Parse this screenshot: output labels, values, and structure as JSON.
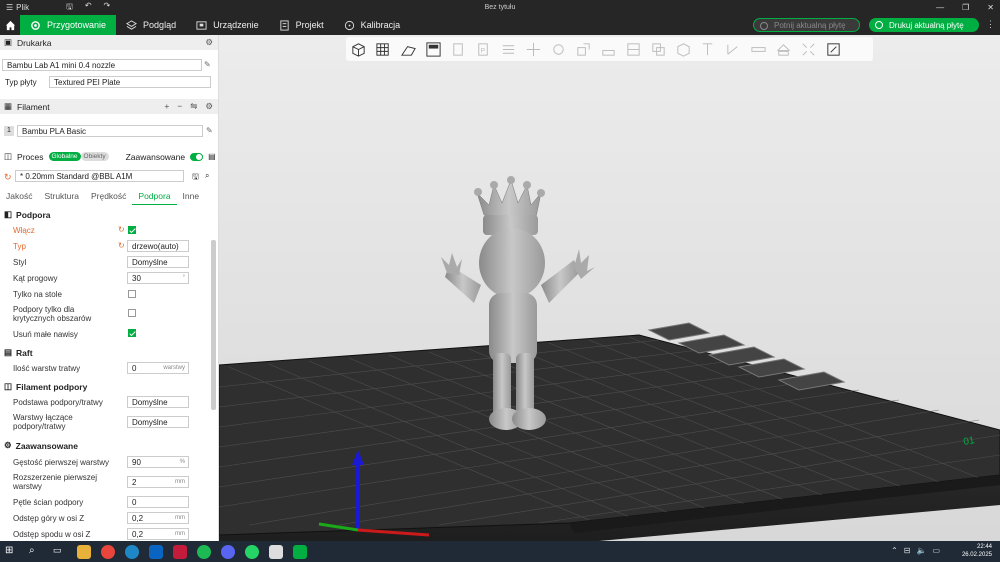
{
  "titlebar": {
    "menu_label": "Plik",
    "title": "Bez tytułu"
  },
  "tabs": [
    {
      "label": "Przygotowanie"
    },
    {
      "label": "Podgląd"
    },
    {
      "label": "Urządzenie"
    },
    {
      "label": "Projekt"
    },
    {
      "label": "Kalibracja"
    }
  ],
  "actions": {
    "slice": "Potnij aktualną płytę",
    "print": "Drukuj aktualną płytę"
  },
  "printer": {
    "section": "Drukarka",
    "name": "Bambu Lab A1 mini 0.4 nozzle",
    "plate_label": "Typ płyty",
    "plate_value": "Textured PEI Plate"
  },
  "filament": {
    "section": "Filament",
    "slot": "1",
    "value": "Bambu PLA Basic"
  },
  "process": {
    "section": "Proces",
    "global": "Globalne",
    "objects": "Obiekty",
    "advanced_label": "Zaawansowane",
    "preset": "* 0.20mm Standard @BBL A1M"
  },
  "subtabs": [
    "Jakość",
    "Struktura",
    "Prędkość",
    "Podpora",
    "Inne"
  ],
  "support": {
    "section": "Podpora",
    "enable_label": "Włącz",
    "type_label": "Typ",
    "type_value": "drzewo(auto)",
    "style_label": "Styl",
    "style_value": "Domyślne",
    "angle_label": "Kąt progowy",
    "angle_value": "30",
    "angle_unit": "°",
    "on_plate_label": "Tylko na stole",
    "critical_label": "Podpory tylko dla krytycznych obszarów",
    "remove_small_label": "Usuń małe nawisy"
  },
  "raft": {
    "section": "Raft",
    "layers_label": "Ilość warstw tratwy",
    "layers_value": "0",
    "layers_unit": "warstwy"
  },
  "support_filament": {
    "section": "Filament podpory",
    "base_label": "Podstawa podpory/tratwy",
    "base_value": "Domyślne",
    "interface_label": "Warstwy łączące podpory/tratwy",
    "interface_value": "Domyślne"
  },
  "advanced": {
    "section": "Zaawansowane",
    "density_label": "Gęstość pierwszej warstwy",
    "density_value": "90",
    "density_unit": "%",
    "expansion_label": "Rozszerzenie pierwszej warstwy",
    "expansion_value": "2",
    "expansion_unit": "mm",
    "loops_label": "Pętle ścian podpory",
    "loops_value": "0",
    "top_z_label": "Odstęp góry w osi Z",
    "top_z_value": "0,2",
    "top_z_unit": "mm",
    "bottom_z_label": "Odstęp spodu w osi Z",
    "bottom_z_value": "0,2",
    "bottom_z_unit": "mm"
  },
  "tray": {
    "time": "22:44",
    "date": "26.02.2025"
  },
  "colors": {
    "accent": "#00ae42",
    "dark": "#262626",
    "orange": "#e36b2d"
  }
}
